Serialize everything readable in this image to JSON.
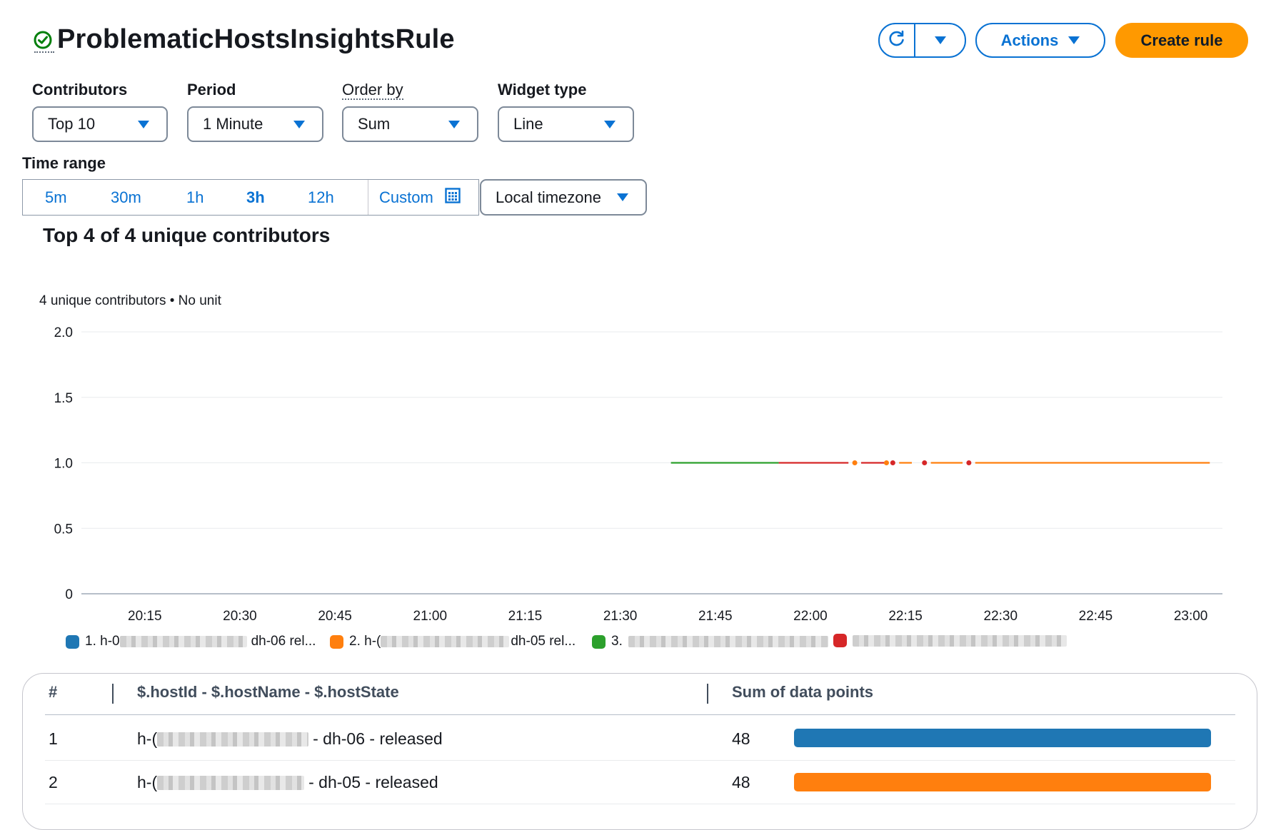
{
  "header": {
    "title": "ProblematicHostsInsightsRule",
    "status": "success",
    "actions_label": "Actions",
    "create_rule_label": "Create rule"
  },
  "controls": {
    "contributors": {
      "label": "Contributors",
      "value": "Top 10"
    },
    "period": {
      "label": "Period",
      "value": "1 Minute"
    },
    "order_by": {
      "label": "Order by",
      "value": "Sum"
    },
    "widget_type": {
      "label": "Widget type",
      "value": "Line"
    }
  },
  "time_range": {
    "label": "Time range",
    "options": [
      "5m",
      "30m",
      "1h",
      "3h",
      "12h"
    ],
    "selected": "3h",
    "custom_label": "Custom",
    "timezone_label": "Local timezone"
  },
  "chart": {
    "title": "Top 4 of 4 unique contributors",
    "subtitle": "4 unique contributors • No unit"
  },
  "chart_data": {
    "type": "line",
    "ylim": [
      0,
      2.0
    ],
    "y_ticks": [
      "2.0",
      "1.5",
      "1.0",
      "0.5",
      "0"
    ],
    "x_ticks": [
      "20:15",
      "20:30",
      "20:45",
      "21:00",
      "21:15",
      "21:30",
      "21:45",
      "22:00",
      "22:15",
      "22:30",
      "22:45",
      "23:00"
    ],
    "xlim": [
      "20:05",
      "23:05"
    ],
    "series": [
      {
        "color": "#2ca02c",
        "segments": [
          [
            "21:38",
            "21:55"
          ]
        ],
        "points": [],
        "value": 1.0
      },
      {
        "color": "#d62728",
        "segments": [
          [
            "21:55",
            "22:06"
          ],
          [
            "22:08",
            "22:12"
          ]
        ],
        "points": [
          "22:13",
          "22:18",
          "22:25"
        ],
        "value": 1.0
      },
      {
        "color": "#ff7f0e",
        "segments": [
          [
            "22:14",
            "22:16"
          ],
          [
            "22:19",
            "22:24"
          ],
          [
            "22:26",
            "23:03"
          ]
        ],
        "points": [
          "22:07",
          "22:12"
        ],
        "value": 1.0
      }
    ],
    "grid": true
  },
  "legend": [
    {
      "prefix": "1. h-0",
      "suffix": "dh-06 rel...",
      "color": "#1f77b4"
    },
    {
      "prefix": "2. h-(",
      "suffix": "dh-05 rel...",
      "color": "#ff7f0e"
    },
    {
      "prefix": "3.",
      "suffix": "",
      "color": "#2ca02c"
    },
    {
      "prefix": "",
      "suffix": "",
      "color": "#d62728"
    }
  ],
  "table": {
    "headers": [
      "#",
      "$.hostId - $.hostName - $.hostState",
      "Sum of data points"
    ],
    "rows": [
      {
        "rank": "1",
        "prefix": "h-(",
        "suffix": "- dh-06 - released",
        "sum": "48",
        "bar_fraction": 1.0,
        "color": "#1f77b4"
      },
      {
        "rank": "2",
        "prefix": "h-(",
        "suffix": "- dh-05 - released",
        "sum": "48",
        "bar_fraction": 1.0,
        "color": "#ff7f0e"
      }
    ]
  }
}
